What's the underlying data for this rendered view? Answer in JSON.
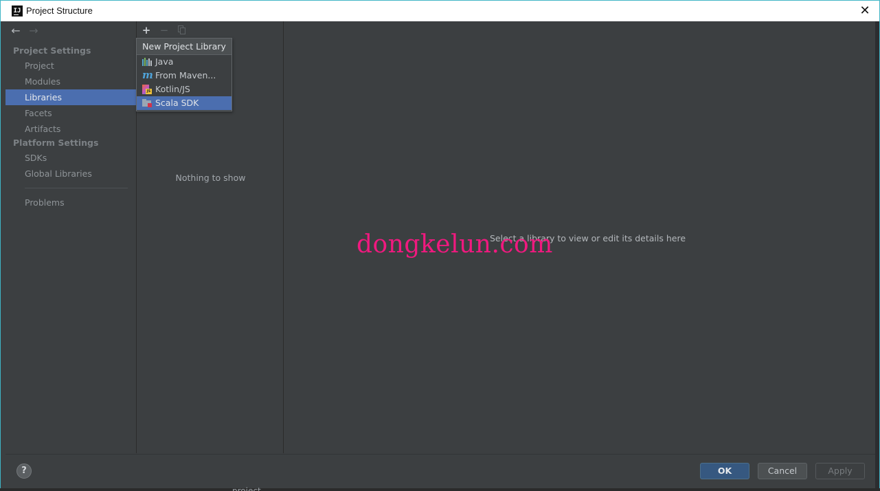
{
  "window": {
    "title": "Project Structure",
    "logo_text": "IJ",
    "close_glyph": "✕"
  },
  "nav": {
    "back_icon": "arrow-left-icon",
    "forward_icon": "arrow-right-icon"
  },
  "sidebar": {
    "project_settings_header": "Project Settings",
    "platform_settings_header": "Platform Settings",
    "items": [
      {
        "label": "Project"
      },
      {
        "label": "Modules"
      },
      {
        "label": "Libraries",
        "selected": true
      },
      {
        "label": "Facets"
      },
      {
        "label": "Artifacts"
      },
      {
        "label": "SDKs"
      },
      {
        "label": "Global Libraries"
      },
      {
        "label": "Problems"
      }
    ]
  },
  "libraries": {
    "empty_text": "Nothing to show"
  },
  "popup": {
    "header": "New Project Library",
    "items": [
      {
        "label": "Java",
        "icon": "java-library-icon"
      },
      {
        "label": "From Maven...",
        "icon": "maven-icon"
      },
      {
        "label": "Kotlin/JS",
        "icon": "kotlin-js-icon"
      },
      {
        "label": "Scala SDK",
        "icon": "scala-sdk-icon",
        "selected": true
      }
    ]
  },
  "details": {
    "placeholder": "Select a library to view or edit its details here"
  },
  "watermark": "dongkelun.com",
  "buttons": {
    "help": "?",
    "ok": "OK",
    "cancel": "Cancel",
    "apply": "Apply"
  },
  "background_text": "project",
  "colors": {
    "accent": "#4b6eaf",
    "ok_button": "#365880",
    "watermark": "#f0197f",
    "panel_bg": "#3c3f41"
  }
}
